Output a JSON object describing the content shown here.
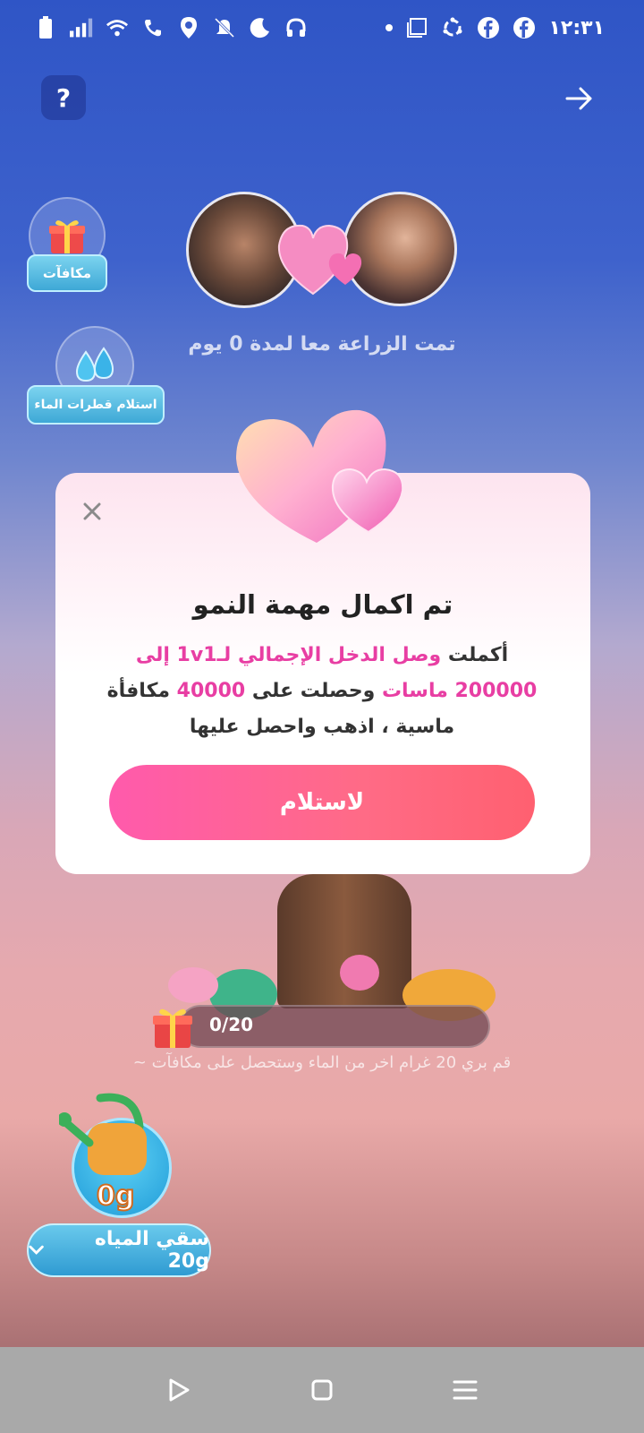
{
  "status_bar": {
    "time": "١٢:٣١",
    "left_icons": [
      "battery-icon",
      "signal-icon",
      "wifi-icon",
      "call-icon",
      "location-icon",
      "mute-icon",
      "moon-icon",
      "headphones-icon"
    ],
    "right_icons": [
      "dot-icon",
      "screen-icon",
      "sync-icon",
      "facebook-icon",
      "facebook-icon"
    ]
  },
  "top_bar": {
    "help_label": "?"
  },
  "side_buttons": {
    "rewards_label": "مكافآت",
    "water_drops_label": "استلام قطرات الماء"
  },
  "couple": {
    "farming_text": "تمت الزراعة معا لمدة 0 يوم"
  },
  "modal": {
    "title": "تم اكمال مهمة النمو",
    "body_part1": "أكملت ",
    "body_highlight1": "وصل الدخل الإجمالي لـ1v1 إلى 200000 ماسات",
    "body_part2": " وحصلت على ",
    "body_highlight2": "40000",
    "body_part3": " مكافأة ماسية ، اذهب واحصل عليها",
    "claim_button": "لاستلام"
  },
  "progress": {
    "text": "0/20",
    "value": 0,
    "max": 20,
    "hint": "قم بري 20 غرام اخر من الماء وستحصل على مكافآت ~"
  },
  "water": {
    "amount": "0g",
    "button_label": "سقي المياه 20g"
  },
  "colors": {
    "accent_pink": "#e83ea3",
    "button_gradient_start": "#ff5aac",
    "button_gradient_end": "#ff6070",
    "water_blue": "#2f9bd2"
  }
}
